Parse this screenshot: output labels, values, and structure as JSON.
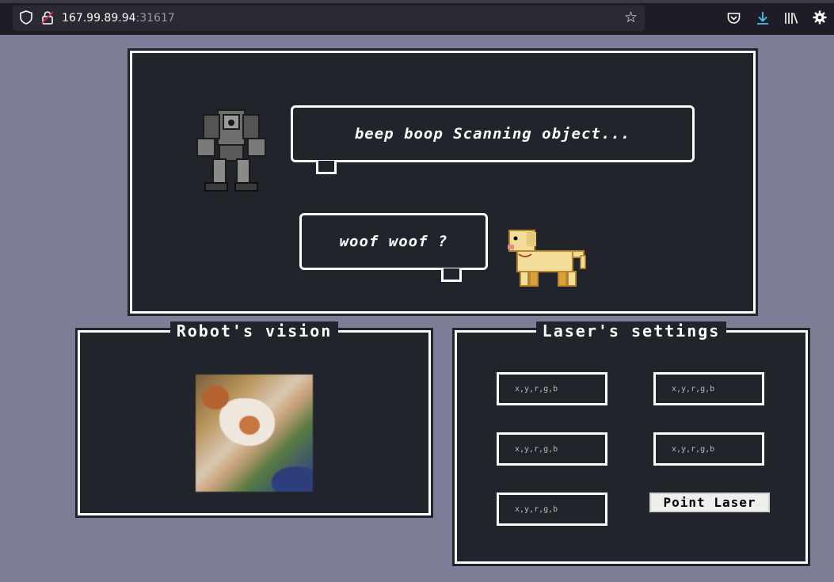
{
  "browser": {
    "url_host": "167.99.89.94",
    "url_port": ":31617"
  },
  "scene": {
    "robot_speech": "beep boop Scanning object...",
    "dog_speech": "woof woof ?"
  },
  "vision_panel": {
    "title": "Robot's vision"
  },
  "laser_panel": {
    "title": "Laser's settings",
    "input_placeholder": "x,y,r,g,b",
    "button_label": "Point Laser"
  },
  "icons": [
    "shield-icon",
    "lock-icon",
    "star-icon",
    "pocket-icon",
    "download-icon",
    "library-icon",
    "settings-icon",
    "robot-sprite",
    "dog-sprite"
  ]
}
